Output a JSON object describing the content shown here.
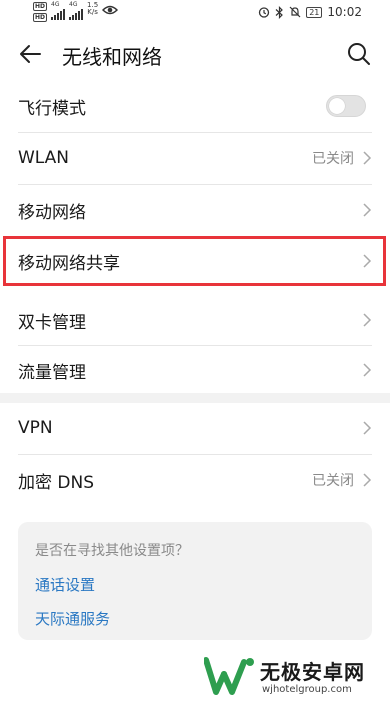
{
  "status_bar": {
    "hd1": "HD",
    "hd2": "HD",
    "net1": "4G",
    "net2": "4G",
    "speed_value": "1.5",
    "speed_unit": "K/s",
    "battery": "21",
    "time": "10:02",
    "icons": [
      "alarm-icon",
      "bluetooth-icon",
      "mute-icon",
      "eye-icon"
    ]
  },
  "header": {
    "title": "无线和网络"
  },
  "items": [
    {
      "label": "飞行模式",
      "toggle": false
    },
    {
      "label": "WLAN",
      "value": "已关闭"
    },
    {
      "label": "移动网络"
    },
    {
      "label": "移动网络共享",
      "highlighted": true
    },
    {
      "label": "双卡管理"
    },
    {
      "label": "流量管理"
    },
    {
      "label": "VPN"
    },
    {
      "label": "加密 DNS",
      "value": "已关闭"
    }
  ],
  "suggestions": {
    "question": "是否在寻找其他设置项？",
    "links": [
      "通话设置",
      "天际通服务"
    ]
  },
  "watermark": {
    "name": "无极安卓网",
    "url": "wjhotelgroup.com"
  },
  "colors": {
    "highlight": "#e8343a",
    "link": "#2a78c3",
    "secondary_text": "#8a8a8a"
  }
}
